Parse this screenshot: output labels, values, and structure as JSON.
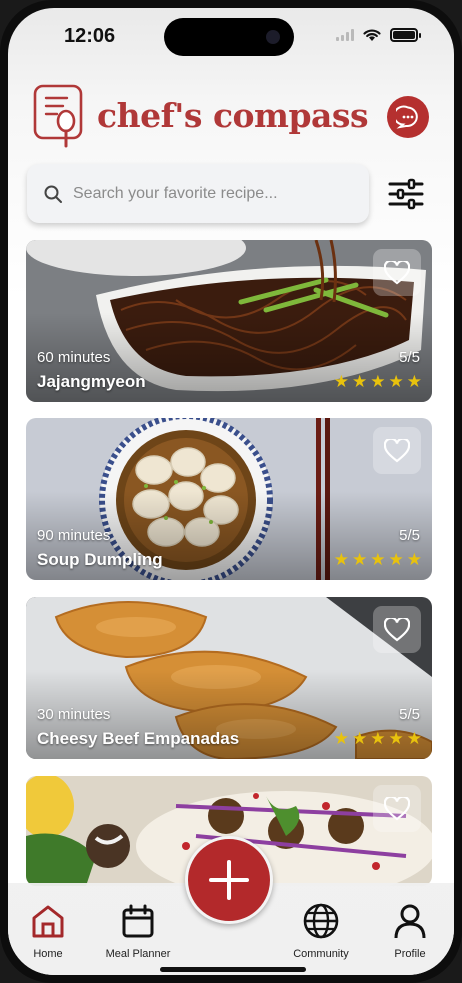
{
  "status_bar": {
    "time": "12:06"
  },
  "header": {
    "brand": "chef's compass"
  },
  "search": {
    "placeholder": "Search your favorite recipe..."
  },
  "recipes": [
    {
      "time": "60 minutes",
      "name": "Jajangmyeon",
      "score": "5/5",
      "rating": 5
    },
    {
      "time": "90 minutes",
      "name": "Soup Dumpling",
      "score": "5/5",
      "rating": 5
    },
    {
      "time": "30 minutes",
      "name": "Cheesy Beef Empanadas",
      "score": "5/5",
      "rating": 5
    },
    {
      "time": "",
      "name": "",
      "score": "",
      "rating": 0
    }
  ],
  "nav": {
    "home": "Home",
    "meal_planner": "Meal Planner",
    "community": "Community",
    "profile": "Profile"
  },
  "colors": {
    "accent": "#b03838",
    "fab": "#b3292b",
    "star": "#e8c20d"
  },
  "icons": [
    "chat-icon",
    "search-icon",
    "sliders-icon",
    "heart-icon",
    "home-icon",
    "calendar-icon",
    "plus-icon",
    "globe-icon",
    "user-icon"
  ]
}
